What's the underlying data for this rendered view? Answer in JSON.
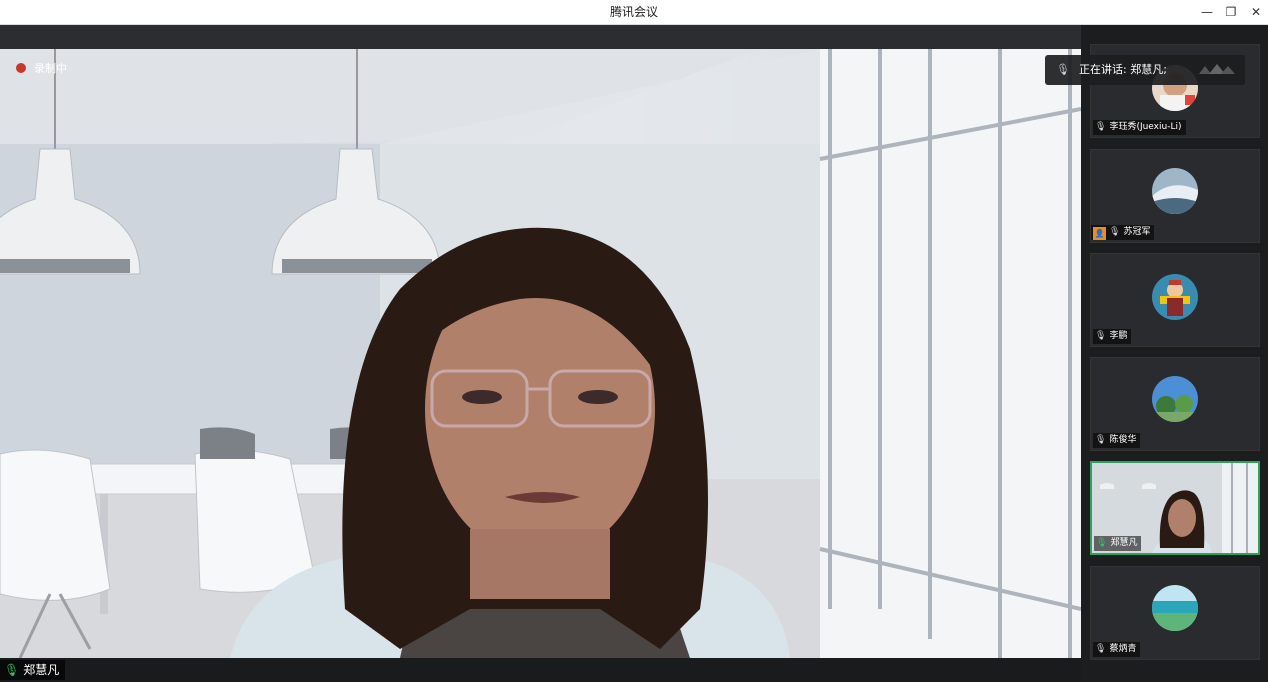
{
  "window": {
    "title": "腾讯会议",
    "controls": {
      "minimize": "—",
      "restore": "❐",
      "close": "✕"
    }
  },
  "main_view": {
    "recording_label": "录制中",
    "speaking_label": "正在讲话: 郑慧凡;",
    "name_tag": "郑慧凡"
  },
  "participants": [
    {
      "name": "李珏秀(Juexiu-Li)",
      "mic": "mic-muted-icon",
      "active": false
    },
    {
      "name": "苏冠军",
      "mic": "mic-muted-icon",
      "active": false,
      "badge": "person-icon"
    },
    {
      "name": "李鹏",
      "mic": "mic-muted-icon",
      "active": false
    },
    {
      "name": "陈俊华",
      "mic": "mic-muted-icon",
      "active": false
    },
    {
      "name": "郑慧凡",
      "mic": "mic-on-icon",
      "active": true
    },
    {
      "name": "蔡炳青",
      "mic": "mic-muted-icon",
      "active": false
    }
  ],
  "colors": {
    "active_border": "#2fa15a",
    "recording_dot": "#c9372c",
    "mic_active": "#37c26f",
    "badge": "#f08a24"
  }
}
